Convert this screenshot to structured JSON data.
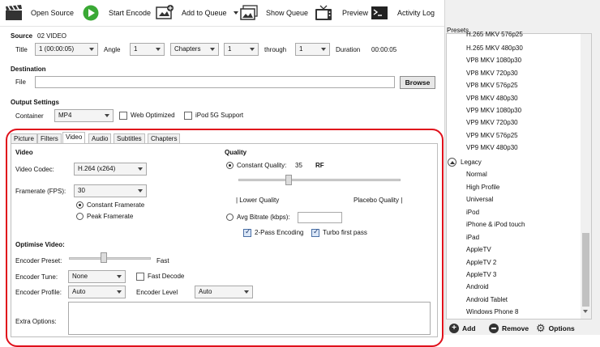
{
  "toolbar": {
    "open_source": "Open Source",
    "start_encode": "Start Encode",
    "add_to_queue": "Add to Queue",
    "show_queue": "Show Queue",
    "preview": "Preview",
    "activity_log": "Activity Log"
  },
  "source": {
    "label": "Source",
    "value": "02 VIDEO",
    "title_label": "Title",
    "title_value": "1 (00:00:05)",
    "angle_label": "Angle",
    "angle_value": "1",
    "range_mode": "Chapters",
    "range_start": "1",
    "through_label": "through",
    "range_end": "1",
    "duration_label": "Duration",
    "duration_value": "00:00:05"
  },
  "destination": {
    "heading": "Destination",
    "file_label": "File",
    "file_value": "",
    "browse_label": "Browse"
  },
  "output_settings": {
    "heading": "Output Settings",
    "container_label": "Container",
    "container_value": "MP4",
    "web_optimized_label": "Web Optimized",
    "ipod_label": "iPod 5G Support"
  },
  "tabs": [
    "Picture",
    "Filters",
    "Video",
    "Audio",
    "Subtitles",
    "Chapters"
  ],
  "video": {
    "heading": "Video",
    "codec_label": "Video Codec:",
    "codec_value": "H.264 (x264)",
    "framerate_label": "Framerate (FPS):",
    "framerate_value": "30",
    "constant_framerate": "Constant Framerate",
    "peak_framerate": "Peak Framerate"
  },
  "quality": {
    "heading": "Quality",
    "constant_quality_label": "Constant Quality:",
    "constant_quality_value": "35",
    "rf_label": "RF",
    "lower_quality": "| Lower Quality",
    "placebo_quality": "Placebo Quality |",
    "avg_bitrate_label": "Avg Bitrate (kbps):",
    "two_pass_label": "2-Pass Encoding",
    "turbo_label": "Turbo first pass"
  },
  "optimise": {
    "heading": "Optimise Video:",
    "preset_label": "Encoder Preset:",
    "preset_value": "Fast",
    "tune_label": "Encoder Tune:",
    "tune_value": "None",
    "fast_decode_label": "Fast Decode",
    "profile_label": "Encoder Profile:",
    "profile_value": "Auto",
    "level_label": "Encoder Level",
    "level_value": "Auto",
    "extra_label": "Extra Options:"
  },
  "presets": {
    "heading": "Presets",
    "items": [
      "H.265 MKV 576p25",
      "H.265 MKV 480p30",
      "VP8 MKV 1080p30",
      "VP8 MKV 720p30",
      "VP8 MKV 576p25",
      "VP8 MKV 480p30",
      "VP9 MKV 1080p30",
      "VP9 MKV 720p30",
      "VP9 MKV 576p25",
      "VP9 MKV 480p30"
    ],
    "legacy_label": "Legacy",
    "legacy_items": [
      "Normal",
      "High Profile",
      "Universal",
      "iPod",
      "iPhone & iPod touch",
      "iPad",
      "AppleTV",
      "AppleTV 2",
      "AppleTV 3",
      "Android",
      "Android Tablet",
      "Windows Phone 8"
    ],
    "add_label": "Add",
    "remove_label": "Remove",
    "options_label": "Options"
  },
  "colors": {
    "annotation": "#e0101b",
    "start_green": "#3aa935"
  }
}
